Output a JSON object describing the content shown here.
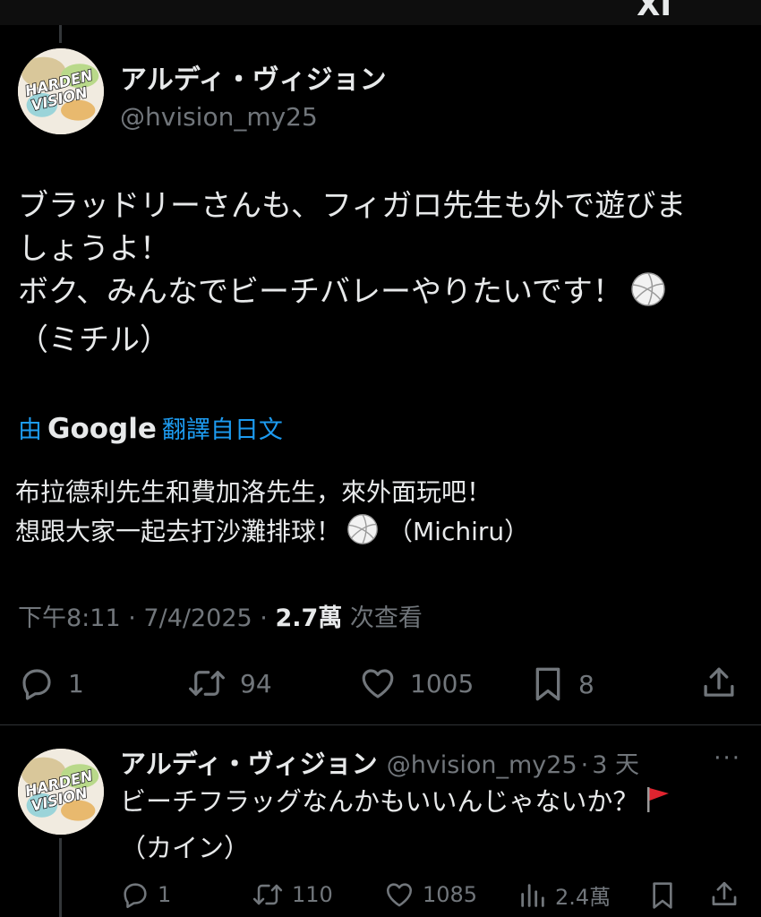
{
  "top_bar": {
    "glyph": "XI"
  },
  "main_tweet": {
    "author": {
      "display_name": "アルディ・ヴィジョン",
      "handle": "@hvision_my25",
      "avatar_text": "HARDEN VISION"
    },
    "text_lines": [
      "ブラッドリーさんも、フィガロ先生も外で遊びま",
      "しょうよ！",
      "ボク、みんなでビーチバレーやりたいです！",
      "（ミチル）"
    ],
    "text_emoji": "volleyball-icon",
    "translation": {
      "prefix": "由",
      "provider": "Google",
      "suffix": "翻譯自日文",
      "lines": [
        "布拉德利先生和費加洛先生，來外面玩吧！",
        "想跟大家一起去打沙灘排球！",
        "（Michiru）"
      ]
    },
    "meta": {
      "time": "下午8:11",
      "sep1": "·",
      "date": "7/4/2025",
      "sep2": "·",
      "views_count": "2.7萬",
      "views_label": "次查看"
    },
    "actions": {
      "replies": "1",
      "reposts": "94",
      "likes": "1005",
      "bookmarks": "8"
    }
  },
  "reply_tweet": {
    "author": {
      "display_name": "アルディ・ヴィジョン",
      "handle": "@hvision_my25",
      "sep": "·",
      "time": "3 天"
    },
    "text_lines": [
      "ビーチフラッグなんかもいいんじゃないか？",
      "（カイン）"
    ],
    "text_emoji": "red-flag-icon",
    "more_label": "···",
    "actions": {
      "replies": "1",
      "reposts": "110",
      "likes": "1085",
      "views": "2.4萬"
    }
  },
  "colors": {
    "background": "#000000",
    "text": "#e7e9ea",
    "muted": "#71767b",
    "link": "#1d9bf0",
    "divider": "#2f3336"
  }
}
